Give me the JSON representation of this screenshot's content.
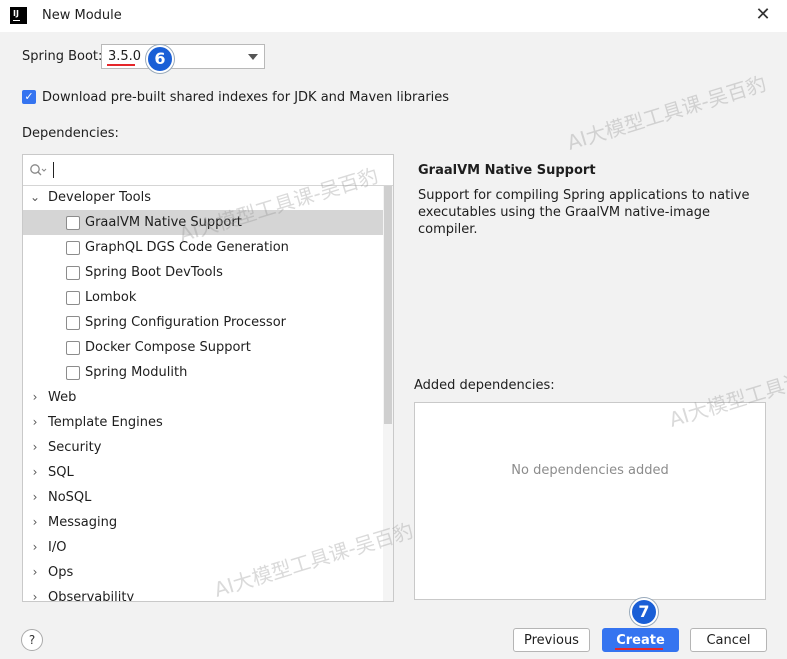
{
  "window": {
    "title": "New Module",
    "app_icon_text": "IJ",
    "close_icon": "close-icon"
  },
  "spring_boot": {
    "label": "Spring Boot:",
    "selected_version": "3.5.0",
    "step_badge": "6"
  },
  "indexes_option": {
    "checked": true,
    "label": "Download pre-built shared indexes for JDK and Maven libraries"
  },
  "dependencies": {
    "label": "Dependencies:",
    "search_value": "",
    "tree": [
      {
        "label": "Developer Tools",
        "expanded": true,
        "children": [
          {
            "label": "GraalVM Native Support",
            "checked": false,
            "selected": true
          },
          {
            "label": "GraphQL DGS Code Generation",
            "checked": false
          },
          {
            "label": "Spring Boot DevTools",
            "checked": false
          },
          {
            "label": "Lombok",
            "checked": false
          },
          {
            "label": "Spring Configuration Processor",
            "checked": false
          },
          {
            "label": "Docker Compose Support",
            "checked": false
          },
          {
            "label": "Spring Modulith",
            "checked": false
          }
        ]
      },
      {
        "label": "Web",
        "expanded": false
      },
      {
        "label": "Template Engines",
        "expanded": false
      },
      {
        "label": "Security",
        "expanded": false
      },
      {
        "label": "SQL",
        "expanded": false
      },
      {
        "label": "NoSQL",
        "expanded": false
      },
      {
        "label": "Messaging",
        "expanded": false
      },
      {
        "label": "I/O",
        "expanded": false
      },
      {
        "label": "Ops",
        "expanded": false
      },
      {
        "label": "Observability",
        "expanded": false
      }
    ]
  },
  "details": {
    "title": "GraalVM Native Support",
    "description": "Support for compiling Spring applications to native executables using the GraalVM native-image compiler."
  },
  "added": {
    "label": "Added dependencies:",
    "empty_text": "No dependencies added"
  },
  "footer": {
    "help_label": "?",
    "previous_label": "Previous",
    "create_label": "Create",
    "cancel_label": "Cancel",
    "step_badge": "7"
  },
  "watermark_text": "AI大模型工具课-吴百豹",
  "colors": {
    "accent": "#3574f0",
    "badge": "#1a5fd6",
    "highlight_underline": "#e5262a"
  }
}
